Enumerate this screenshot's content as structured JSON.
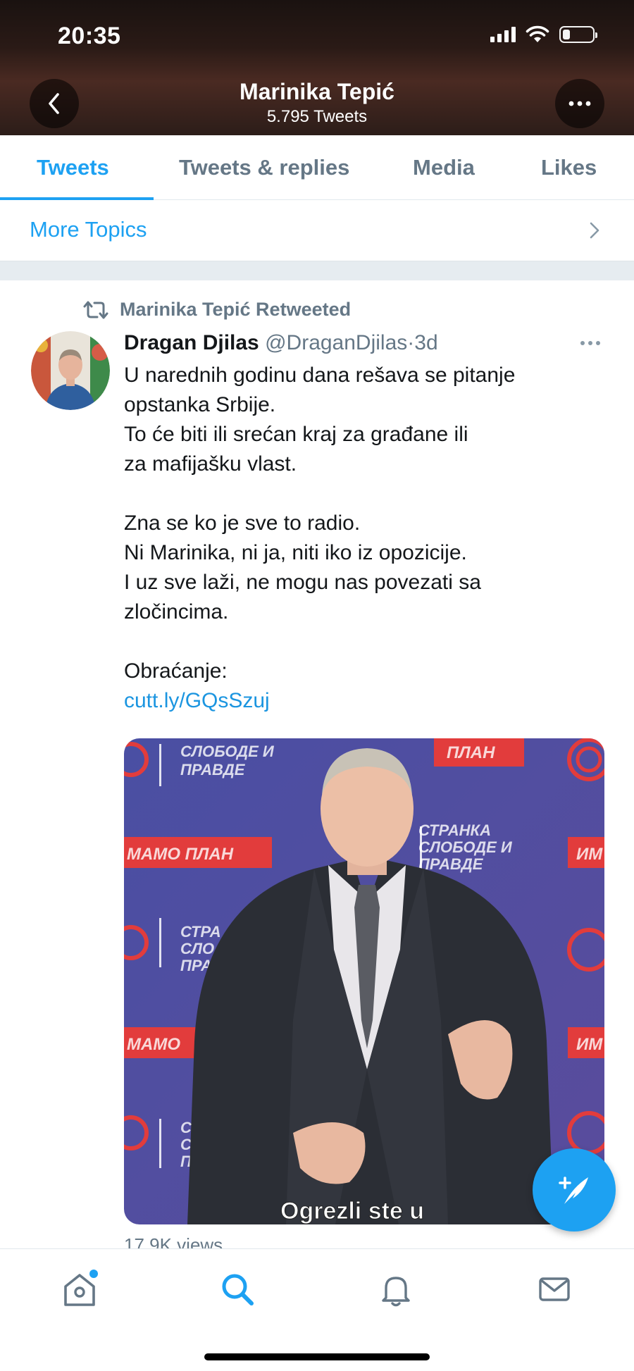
{
  "status_bar": {
    "time": "20:35",
    "battery_level": 0.25
  },
  "header": {
    "title": "Marinika Tepić",
    "subtitle": "5.795 Tweets"
  },
  "tabs": [
    {
      "label": "Tweets",
      "active": true
    },
    {
      "label": "Tweets & replies",
      "active": false
    },
    {
      "label": "Media",
      "active": false
    },
    {
      "label": "Likes",
      "active": false
    }
  ],
  "topics": {
    "label": "More Topics"
  },
  "tweet": {
    "retweet_label": "Marinika Tepić Retweeted",
    "author_name": "Dragan Djilas",
    "author_handle": "@DraganDjilas",
    "separator": "·",
    "age": "3d",
    "lines": [
      "U narednih godinu dana rešava se pitanje",
      "opstanka Srbije.",
      "To će biti ili srećan kraj za građane ili",
      "za mafijašku vlast.",
      "",
      "Zna se ko je sve to radio.",
      "Ni Marinika, ni ja, niti iko iz opozicije.",
      "I uz sve laži, ne mogu nas povezati sa",
      "zločincima.",
      "",
      "Obraćanje:"
    ],
    "link": "cutt.ly/GQsSzuj",
    "media": {
      "banner_texts": [
        "СЛОБОДЕ И",
        "ПРАВДЕ",
        "ПЛАН",
        "СТРАНКА",
        "СЛОБОДЕ И",
        "ПРАВДЕ",
        "МАМО ПЛАН",
        "ИМ",
        "СТРА",
        "СЛО",
        "ПРА",
        "МАМО",
        "ИМ",
        "С",
        "СЛ",
        "ПРАВД"
      ],
      "caption": "Ogrezli ste u"
    },
    "views": "17,9K views"
  },
  "colors": {
    "accent": "#1da1f2",
    "muted": "#657786",
    "text": "#14171a"
  },
  "icons": {
    "back": "chevron-left-icon",
    "more": "ellipsis-icon",
    "topics": "chevron-right-icon",
    "retweet": "retweet-icon",
    "compose": "compose-feather-icon",
    "nav": [
      "home-icon",
      "search-icon",
      "bell-icon",
      "mail-icon"
    ]
  }
}
